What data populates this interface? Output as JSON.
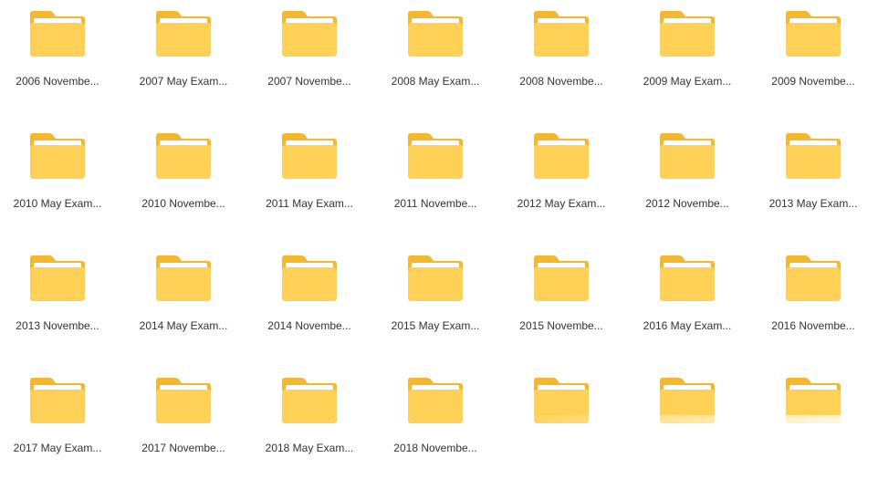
{
  "colors": {
    "folder_back": "#F4B82E",
    "folder_front": "#FFD257",
    "folder_paper": "#FFFFFF",
    "label_text": "#333333"
  },
  "icon": "folder-icon",
  "folders": [
    {
      "label": "2006 Novembe..."
    },
    {
      "label": "2007 May Exam..."
    },
    {
      "label": "2007 Novembe..."
    },
    {
      "label": "2008 May Exam..."
    },
    {
      "label": "2008 Novembe..."
    },
    {
      "label": "2009 May Exam..."
    },
    {
      "label": "2009 Novembe..."
    },
    {
      "label": "2010 May Exam..."
    },
    {
      "label": "2010 Novembe..."
    },
    {
      "label": "2011 May Exam..."
    },
    {
      "label": "2011 Novembe..."
    },
    {
      "label": "2012 May Exam..."
    },
    {
      "label": "2012 Novembe..."
    },
    {
      "label": "2013 May Exam..."
    },
    {
      "label": "2013 Novembe..."
    },
    {
      "label": "2014 May Exam..."
    },
    {
      "label": "2014 Novembe..."
    },
    {
      "label": "2015 May Exam..."
    },
    {
      "label": "2015 Novembe..."
    },
    {
      "label": "2016 May Exam..."
    },
    {
      "label": "2016 Novembe..."
    },
    {
      "label": "2017 May Exam..."
    },
    {
      "label": "2017 Novembe..."
    },
    {
      "label": "2018 May Exam..."
    },
    {
      "label": "2018 Novembe..."
    },
    {
      "label": ""
    },
    {
      "label": ""
    },
    {
      "label": ""
    }
  ]
}
